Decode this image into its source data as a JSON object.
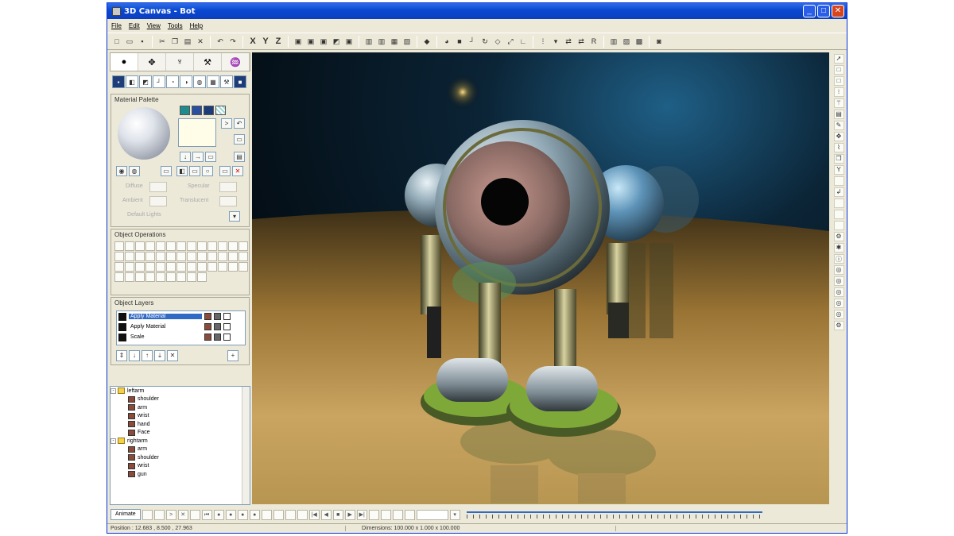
{
  "window": {
    "title": "3D Canvas - Bot"
  },
  "menu": [
    "File",
    "Edit",
    "View",
    "Tools",
    "Help"
  ],
  "toolbar": {
    "leading": [
      "new-icon",
      "open-icon",
      "save-icon",
      "cut-icon",
      "copy-icon",
      "paste-icon",
      "delete-icon",
      "undo-icon",
      "redo-icon"
    ],
    "axes": [
      "X",
      "Y",
      "Z"
    ]
  },
  "left_tabs": [
    "tab-object",
    "tab-move",
    "tab-deform",
    "tab-tools",
    "tab-scene"
  ],
  "material_palette": {
    "title": "Material Palette",
    "swatch_colors": [
      "#1e8c8c",
      "#2b4fa0",
      "#1b3c78",
      "#9fd6d6"
    ],
    "props": [
      "Diffuse",
      "Specular",
      "Ambient",
      "Translucent"
    ],
    "mode": "Default Lights"
  },
  "object_operations": {
    "title": "Object Operations"
  },
  "object_layers": {
    "title": "Object Layers",
    "rows": [
      "Apply Material",
      "Apply Material",
      "Scale"
    ]
  },
  "tree": {
    "groups": [
      {
        "label": "leftarm",
        "children": [
          "shoulder",
          "arm",
          "wrist",
          "hand",
          "Face"
        ]
      },
      {
        "label": "rightarm",
        "children": [
          "arm",
          "shoulder",
          "wrist",
          "gun"
        ]
      }
    ]
  },
  "timeline": {
    "animate_label": "Animate"
  },
  "status": {
    "position": "Position : 12.683 , 8.500 , 27.963",
    "dimensions": "Dimensions: 100.000 x 1.000 x 100.000"
  },
  "colors": {
    "titlebar": "#0a48d0",
    "selection": "#316ac5"
  }
}
